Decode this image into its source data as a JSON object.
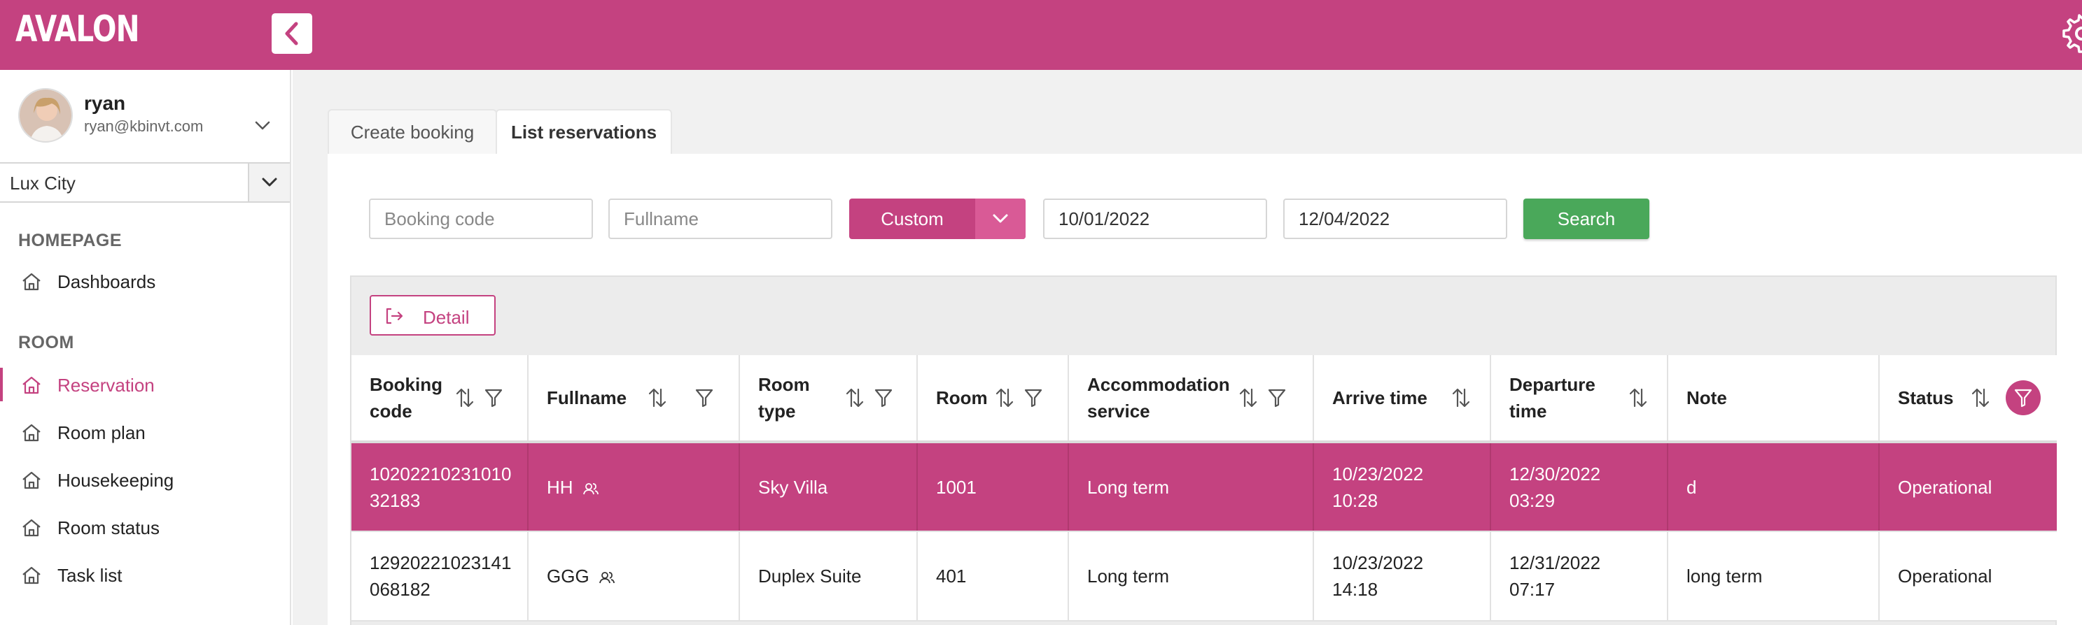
{
  "app": {
    "logo": "AVALON"
  },
  "user": {
    "name": "ryan",
    "email": "ryan@kbinvt.com"
  },
  "hotel_select": {
    "value": "Lux City"
  },
  "sidebar": {
    "sections": [
      {
        "title": "HOMEPAGE",
        "items": [
          {
            "label": "Dashboards",
            "icon": "home-icon"
          }
        ]
      },
      {
        "title": "ROOM",
        "items": [
          {
            "label": "Reservation",
            "icon": "home-icon",
            "active": true
          },
          {
            "label": "Room plan",
            "icon": "home-icon"
          },
          {
            "label": "Housekeeping",
            "icon": "home-icon"
          },
          {
            "label": "Room status",
            "icon": "home-icon"
          },
          {
            "label": "Task list",
            "icon": "home-icon"
          }
        ]
      }
    ]
  },
  "tabs": [
    {
      "label": "Create booking"
    },
    {
      "label": "List reservations",
      "active": true
    }
  ],
  "filters": {
    "booking_code_placeholder": "Booking code",
    "fullname_placeholder": "Fullname",
    "range_select": "Custom",
    "date_from": "10/01/2022",
    "date_to": "12/04/2022",
    "search_label": "Search"
  },
  "toolbar": {
    "detail_label": "Detail"
  },
  "table": {
    "columns": [
      {
        "label": "Booking code",
        "sortable": true,
        "filterable": true
      },
      {
        "label": "Fullname",
        "sortable": true,
        "filterable": true
      },
      {
        "label": "Room type",
        "sortable": true,
        "filterable": true
      },
      {
        "label": "Room",
        "sortable": true,
        "filterable": true
      },
      {
        "label": "Accommodation service",
        "sortable": true,
        "filterable": true
      },
      {
        "label": "Arrive time",
        "sortable": true,
        "filterable": false
      },
      {
        "label": "Departure time",
        "sortable": true,
        "filterable": false
      },
      {
        "label": "Note",
        "sortable": false,
        "filterable": false
      },
      {
        "label": "Status",
        "sortable": true,
        "filterable": true,
        "filter_active": true
      }
    ],
    "rows": [
      {
        "booking_code": "10202210231010 32183",
        "fullname": "HH",
        "room_type": "Sky Villa",
        "room": "1001",
        "service": "Long term",
        "arrive": "10/23/2022 10:28",
        "departure": "12/30/2022 03:29",
        "note": "d",
        "status": "Operational",
        "selected": true
      },
      {
        "booking_code": "12920221023141 068182",
        "fullname": "GGG",
        "room_type": "Duplex Suite",
        "room": "401",
        "service": "Long term",
        "arrive": "10/23/2022 14:18",
        "departure": "12/31/2022 07:17",
        "note": "long term",
        "status": "Operational",
        "selected": false
      }
    ]
  },
  "colors": {
    "brand": "#c44280",
    "search": "#4aa85a"
  }
}
